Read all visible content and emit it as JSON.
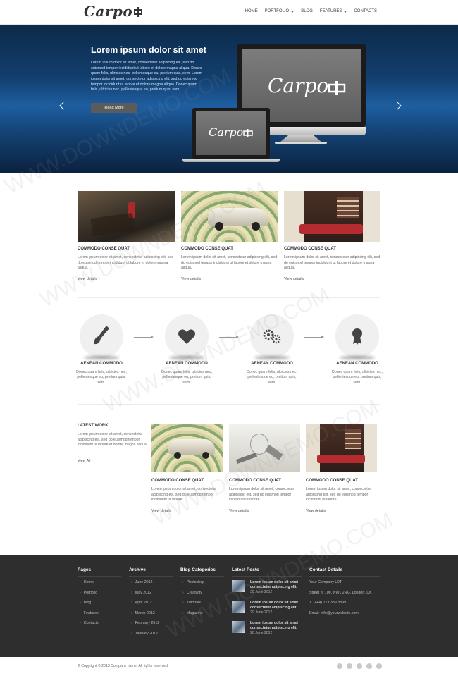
{
  "header": {
    "logo": "Carpo",
    "nav": [
      "HOME",
      "PORTFOLIO",
      "BLOG",
      "FEATURES",
      "CONTACTS"
    ]
  },
  "hero": {
    "title": "Lorem ipsum dolor sit amet",
    "text": "Lorem ipsum dolor sit amet, consectetur adipiscing elit, sed do euismod tempor incididunt ut labore et dolore magna aliqua. Donec quam felis, ultricies nec, pellentesque eu, pretium quis, sem. Lorem ipsum dolor sit amet, consectetur adipiscing elit, sed do euismod tempor incididunt ut labore et dolore magna aliqua. Donec quam felis, ultricies nec, pellentesque eu, pretium quis, sem.",
    "button": "Read More",
    "screen_logo": "Carpo"
  },
  "cards": [
    {
      "title": "COMMODO CONSE QUAT",
      "text": "Lorem ipsum dolor sit amet, consectetur adipiscing elit, sed do euismod tempor incididunt ut labore et dolore magna aliqua.",
      "link": "View details"
    },
    {
      "title": "COMMODO CONSE QUAT",
      "text": "Lorem ipsum dolor sit amet, consectetur adipiscing elit, sed do euismod tempor incididunt ut labore et dolore magna aliqua.",
      "link": "View details"
    },
    {
      "title": "COMMODO CONSE QUAT",
      "text": "Lorem ipsum dolor sit amet, consectetur adipiscing elit, sed do euismod tempor incididunt ut labore et dolore magna aliqua.",
      "link": "View details"
    }
  ],
  "features": [
    {
      "icon": "brush-icon",
      "title": "AENEAN COMMODO",
      "text": "Donec quam felis, ultricies nec, pellentesque eu, pretium quis, sem."
    },
    {
      "icon": "heart-icon",
      "title": "AENEAN COMMODO",
      "text": "Donec quam felis, ultricies nec, pellentesque eu, pretium quis, sem."
    },
    {
      "icon": "gears-icon",
      "title": "AENEAN COMMODO",
      "text": "Donec quam felis, ultricies nec, pellentesque eu, pretium quis, sem."
    },
    {
      "icon": "award-icon",
      "title": "AENEAN COMMODO",
      "text": "Donec quam felis, ultricies nec, pellentesque eu, pretium quis, sem."
    }
  ],
  "latest": {
    "title": "LATEST WORK",
    "text": "Lorem ipsum dolor sit amet, consectetur adipiscing elit, sed do euismod tempor incididunt ut labore et dolore magna aliqua.",
    "link": "View All",
    "items": [
      {
        "title": "COMMODO CONSE QUAT",
        "text": "Lorem ipsum dolor sit amet, consectetur adipiscing elit, sed do euismod tempor incididunt ut labore.",
        "link": "View details"
      },
      {
        "title": "COMMODO CONSE QUAT",
        "text": "Lorem ipsum dolor sit amet, consectetur adipiscing elit, sed do euismod tempor incididunt ut labore.",
        "link": "View details"
      },
      {
        "title": "COMMODO CONSE QUAT",
        "text": "Lorem ipsum dolor sit amet, consectetur adipiscing elit, sed do euismod tempor incididunt ut labore.",
        "link": "View details"
      }
    ]
  },
  "footer": {
    "pages": {
      "title": "Pages",
      "items": [
        "Home",
        "Portfolio",
        "Blog",
        "Features",
        "Contacts"
      ]
    },
    "archive": {
      "title": "Archive",
      "items": [
        "June 2012",
        "May 2012",
        "April 2012",
        "March 2012",
        "February 2012",
        "January 2012"
      ]
    },
    "categories": {
      "title": "Blog Categories",
      "items": [
        "Photoshop",
        "Creativity",
        "Tutorials",
        "Magazine"
      ]
    },
    "posts": {
      "title": "Latest Posts",
      "items": [
        {
          "title": "Lorem ipsum dolor sit amet consectetur adipiscing elit.",
          "date": "30 June 2012"
        },
        {
          "title": "Lorem ipsum dolor sit amet consectetur adipiscing elit.",
          "date": "29 June 2012"
        },
        {
          "title": "Lorem ipsum dolor sit amet consectetur adipiscing elit.",
          "date": "28 June 2012"
        }
      ]
    },
    "contact": {
      "title": "Contact Details",
      "company": "Your Company LDT",
      "street": "Street nr 100, NW1 2RG, London, UK",
      "phone": "T. (+44) 773 339 8899",
      "email": "Email: info@yourwebsite.com"
    },
    "copyright": "© Copyright © 2013 Company name. All rights reserved."
  },
  "watermark": "WWW.DOWNDEMO.COM"
}
